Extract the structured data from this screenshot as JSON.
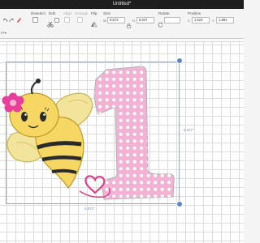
{
  "window": {
    "title": "Untitled*"
  },
  "toolbar": {
    "left_label": "Pkr ▾",
    "partial_label": "FF▾",
    "labels": {
      "deselect": "Deselect",
      "edit": "Edit",
      "align": "Align",
      "arrange": "Arrange",
      "flip": "Flip",
      "size": "Size",
      "rotate": "Rotate",
      "position": "Position"
    },
    "size": {
      "w_label": "W",
      "w_value": "9.573",
      "h_label": "H",
      "h_value": "6.647"
    },
    "position": {
      "x_label": "X",
      "x_value": "1.623",
      "y_label": "Y",
      "y_value": "1.881"
    }
  },
  "canvas": {
    "width_label": "9.573\"",
    "height_label": "6.647\""
  },
  "colors": {
    "bee_yellow": "#f6d764",
    "bee_stripe": "#2a2a2a",
    "wing": "#f3e49c",
    "number_pink": "#f1b2d3",
    "flower": "#e8409a",
    "heart": "#d9418c",
    "handle": "#5c86c4"
  }
}
